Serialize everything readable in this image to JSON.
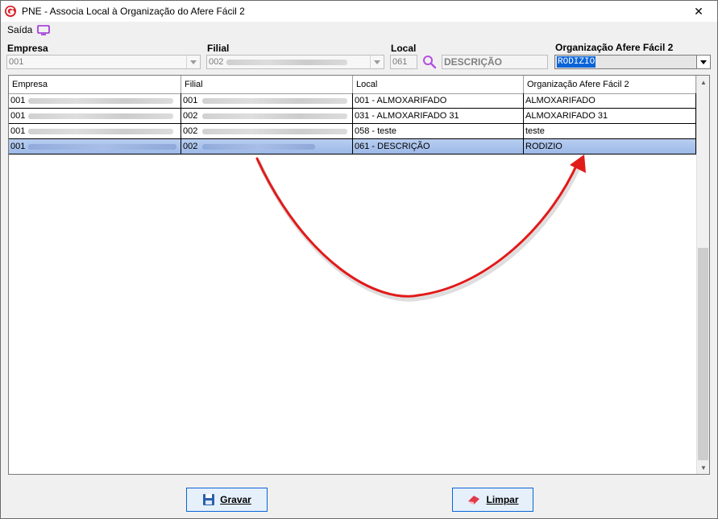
{
  "window": {
    "title": "PNE - Associa Local à Organização do Afere Fácil 2",
    "close_glyph": "✕"
  },
  "menu": {
    "saida_label": "Saída"
  },
  "filters": {
    "empresa": {
      "label": "Empresa",
      "value": "001"
    },
    "filial": {
      "label": "Filial",
      "value": "002"
    },
    "local": {
      "label": "Local",
      "code": "061",
      "description": "DESCRIÇÃO"
    },
    "organizacao": {
      "label": "Organização Afere Fácil 2",
      "selected": "RODIZIO"
    }
  },
  "table": {
    "columns": [
      "Empresa",
      "Filial",
      "Local",
      "Organização Afere Fácil 2"
    ],
    "rows": [
      {
        "empresa": "001",
        "filial": "001",
        "local": "001 - ALMOXARIFADO",
        "organizacao": "ALMOXARIFADO",
        "selected": false
      },
      {
        "empresa": "001",
        "filial": "002",
        "local": "031 - ALMOXARIFADO 31",
        "organizacao": "ALMOXARIFADO 31",
        "selected": false
      },
      {
        "empresa": "001",
        "filial": "002",
        "local": "058 - teste",
        "organizacao": "teste",
        "selected": false
      },
      {
        "empresa": "001",
        "filial": "002",
        "local": "061 - DESCRIÇÃO",
        "organizacao": "RODIZIO",
        "selected": true
      }
    ]
  },
  "buttons": {
    "gravar": {
      "label": "Gravar",
      "icon": "floppy-disk-icon"
    },
    "limpar": {
      "label": "Limpar",
      "icon": "eraser-icon"
    }
  },
  "colors": {
    "accent": "#0a64d8",
    "annotation_arrow": "#e21a1a",
    "selection_row": "#aac4ec"
  }
}
